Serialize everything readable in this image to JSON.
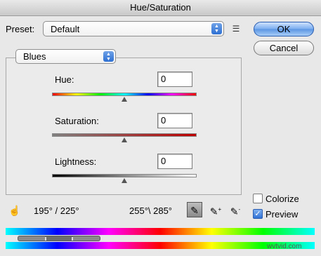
{
  "window": {
    "title": "Hue/Saturation"
  },
  "preset": {
    "label": "Preset:",
    "value": "Default",
    "menu_icon": "list-menu-icon"
  },
  "buttons": {
    "ok": "OK",
    "cancel": "Cancel"
  },
  "channel": {
    "value": "Blues"
  },
  "hue": {
    "label": "Hue:",
    "value": "0"
  },
  "saturation": {
    "label": "Saturation:",
    "value": "0"
  },
  "lightness": {
    "label": "Lightness:",
    "value": "0"
  },
  "options": {
    "colorize_label": "Colorize",
    "colorize_checked": false,
    "preview_label": "Preview",
    "preview_checked": true
  },
  "range": {
    "left": "195° / 225°",
    "right": "255°\\ 285°"
  },
  "tools": [
    "hand-adjust-icon",
    "eyedropper-icon",
    "eyedropper-plus-icon",
    "eyedropper-minus-icon"
  ],
  "watermark": "wvtvid.com"
}
